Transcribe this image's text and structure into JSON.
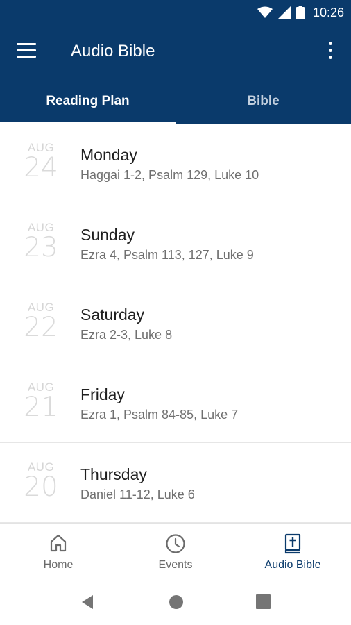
{
  "status": {
    "time": "10:26"
  },
  "appbar": {
    "title": "Audio Bible",
    "menu_icon": "hamburger-icon",
    "more_icon": "more-vert-icon"
  },
  "tabs": [
    {
      "label": "Reading Plan",
      "active": true
    },
    {
      "label": "Bible",
      "active": false
    }
  ],
  "readings": [
    {
      "month": "AUG",
      "day": "24",
      "weekday": "Monday",
      "passages": "Haggai 1-2, Psalm 129, Luke 10"
    },
    {
      "month": "AUG",
      "day": "23",
      "weekday": "Sunday",
      "passages": "Ezra 4, Psalm 113, 127, Luke 9"
    },
    {
      "month": "AUG",
      "day": "22",
      "weekday": "Saturday",
      "passages": "Ezra 2-3, Luke 8"
    },
    {
      "month": "AUG",
      "day": "21",
      "weekday": "Friday",
      "passages": "Ezra 1, Psalm 84-85, Luke 7"
    },
    {
      "month": "AUG",
      "day": "20",
      "weekday": "Thursday",
      "passages": "Daniel 11-12, Luke 6"
    }
  ],
  "bottom_nav": [
    {
      "label": "Home",
      "icon": "home-icon",
      "active": false
    },
    {
      "label": "Events",
      "icon": "clock-icon",
      "active": false
    },
    {
      "label": "Audio Bible",
      "icon": "bible-icon",
      "active": true
    }
  ],
  "colors": {
    "primary": "#0a3a6b",
    "inactive_tab": "#c2cfde",
    "date_gray": "#d6d6d6"
  }
}
